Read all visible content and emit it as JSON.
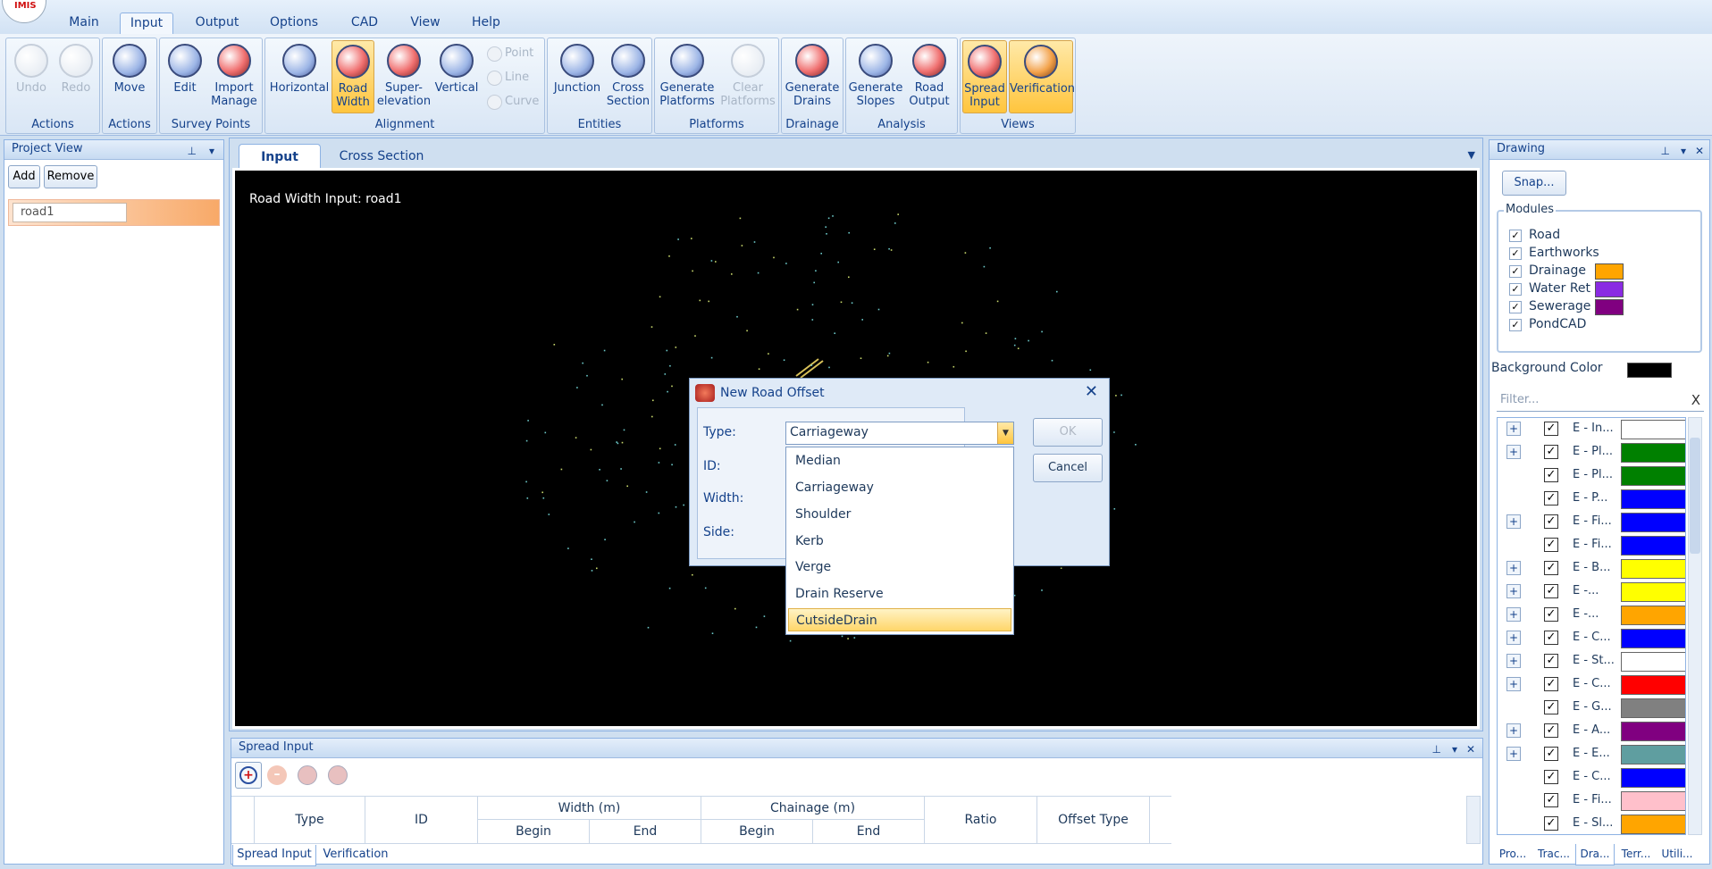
{
  "app": {
    "logo_text": "IMIS"
  },
  "menu": {
    "items": [
      "Main",
      "Input",
      "Output",
      "Options",
      "CAD",
      "View",
      "Help"
    ],
    "active": "Input"
  },
  "ribbon": {
    "groups": [
      {
        "label": "Actions",
        "buttons": [
          "Undo",
          "Redo"
        ]
      },
      {
        "label": "Actions",
        "buttons": [
          "Move"
        ]
      },
      {
        "label": "Survey Points",
        "buttons": [
          "Edit",
          "Import\nManage"
        ]
      },
      {
        "label": "Alignment",
        "buttons": [
          "Horizontal",
          "Road\nWidth",
          "Super-\nelevation",
          "Vertical"
        ],
        "small": [
          "Point",
          "Line",
          "Curve"
        ]
      },
      {
        "label": "Entities",
        "buttons": [
          "Junction",
          "Cross\nSection"
        ]
      },
      {
        "label": "Platforms",
        "buttons": [
          "Generate\nPlatforms",
          "Clear\nPlatforms"
        ]
      },
      {
        "label": "Drainage",
        "buttons": [
          "Generate\nDrains"
        ]
      },
      {
        "label": "Analysis",
        "buttons": [
          "Generate\nSlopes",
          "Road\nOutput"
        ]
      },
      {
        "label": "Views",
        "buttons": [
          "Spread\nInput",
          "Verification"
        ]
      }
    ]
  },
  "project_view": {
    "title": "Project View",
    "add": "Add",
    "remove": "Remove",
    "items": [
      "road1"
    ]
  },
  "doc_tabs": {
    "tabs": [
      "Input",
      "Cross Section"
    ],
    "active": "Input"
  },
  "canvas": {
    "title": "Road Width Input: road1"
  },
  "dialog": {
    "title": "New Road Offset",
    "labels": {
      "type": "Type:",
      "id": "ID:",
      "width": "Width:",
      "side": "Side:"
    },
    "type_value": "Carriageway",
    "ok": "OK",
    "cancel": "Cancel",
    "options": [
      "Median",
      "Carriageway",
      "Shoulder",
      "Kerb",
      "Verge",
      "Drain Reserve",
      "CutsideDrain"
    ],
    "highlighted": "CutsideDrain"
  },
  "drawing": {
    "title": "Drawing",
    "snap": "Snap...",
    "modules_label": "Modules",
    "modules": [
      {
        "name": "Road",
        "color": null
      },
      {
        "name": "Earthworks",
        "color": null
      },
      {
        "name": "Drainage",
        "color": "#ffa500"
      },
      {
        "name": "Water Ret",
        "color": "#8a2be2"
      },
      {
        "name": "Sewerage",
        "color": "#800080"
      },
      {
        "name": "PondCAD",
        "color": null
      }
    ],
    "background_label": "Background Color",
    "background_color": "#000000",
    "filter_placeholder": "Filter...",
    "filter_clear": "X",
    "layers": [
      {
        "label": "E - In...",
        "color": "#ffffff",
        "exp": true
      },
      {
        "label": "E - Pl...",
        "color": "#008000",
        "exp": true
      },
      {
        "label": "E - Pl...",
        "color": "#008000",
        "exp": false
      },
      {
        "label": "E - P...",
        "color": "#0000ff",
        "exp": false
      },
      {
        "label": "E - Fi...",
        "color": "#0000ff",
        "exp": true
      },
      {
        "label": "E - Fi...",
        "color": "#0000ff",
        "exp": false
      },
      {
        "label": "E - B...",
        "color": "#ffff00",
        "exp": true
      },
      {
        "label": "E -...",
        "color": "#ffff00",
        "exp": true
      },
      {
        "label": "E -...",
        "color": "#ffa500",
        "exp": true
      },
      {
        "label": "E - C...",
        "color": "#0000ff",
        "exp": true
      },
      {
        "label": "E - St...",
        "color": "#ffffff",
        "exp": true
      },
      {
        "label": "E - C...",
        "color": "#ff0000",
        "exp": true
      },
      {
        "label": "E - G...",
        "color": "#808080",
        "exp": false
      },
      {
        "label": "E - A...",
        "color": "#800080",
        "exp": true
      },
      {
        "label": "E - E...",
        "color": "#5f9ea0",
        "exp": true
      },
      {
        "label": "E - C...",
        "color": "#0000ff",
        "exp": false
      },
      {
        "label": "E - Fi...",
        "color": "#ffc0cb",
        "exp": false
      },
      {
        "label": "E - Sl...",
        "color": "#ffa500",
        "exp": false
      }
    ],
    "bottom_tabs": [
      "Pro...",
      "Trac...",
      "Dra...",
      "Terr...",
      "Utili..."
    ],
    "bottom_active": "Dra..."
  },
  "spread_input": {
    "title": "Spread Input",
    "columns": {
      "type": "Type",
      "id": "ID",
      "width": "Width (m)",
      "chainage": "Chainage (m)",
      "begin": "Begin",
      "end": "End",
      "ratio": "Ratio",
      "offset_type": "Offset Type"
    },
    "tabs": [
      "Spread Input",
      "Verification"
    ],
    "active": "Spread Input"
  }
}
